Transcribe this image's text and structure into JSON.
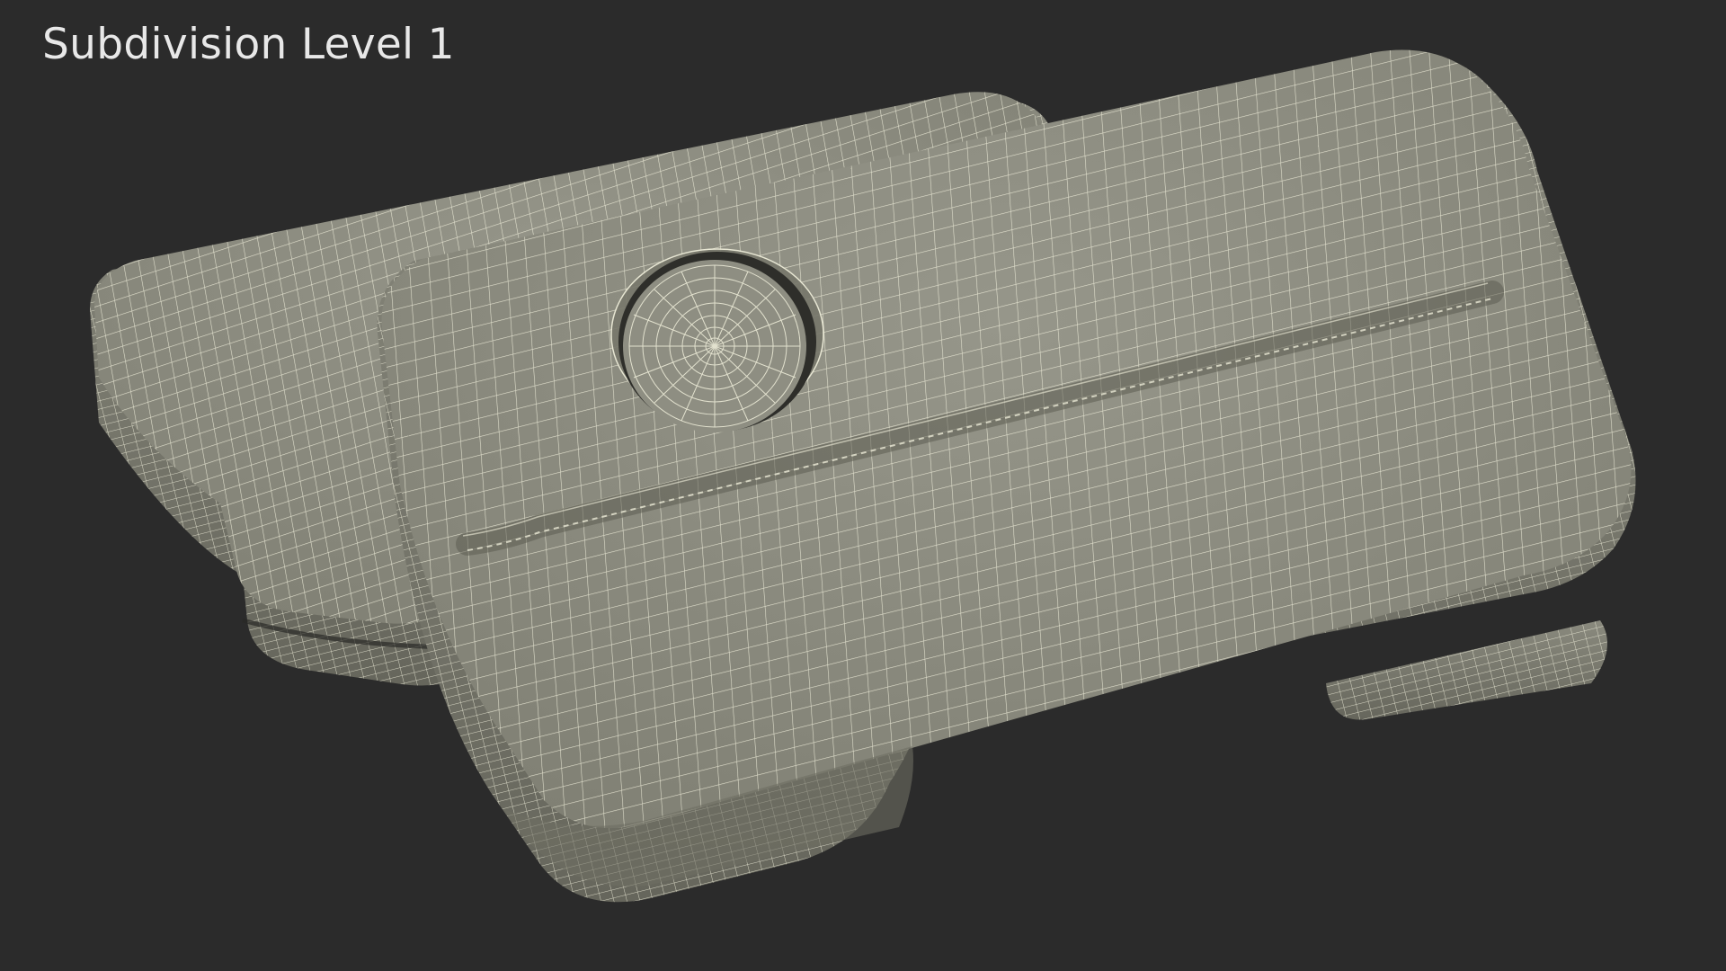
{
  "viewport": {
    "caption": "Subdivision Level 1"
  },
  "colors": {
    "background": "#2b2b2b",
    "mesh_surface": "#8c8c7e",
    "mesh_surface_dark": "#6e6e62",
    "wireframe": "#f1f0dc",
    "caption_text": "#e8e8e8"
  },
  "objects": [
    {
      "name": "back-case-mesh-icon"
    },
    {
      "name": "front-case-mesh-icon"
    },
    {
      "name": "round-button-mesh-icon"
    }
  ]
}
